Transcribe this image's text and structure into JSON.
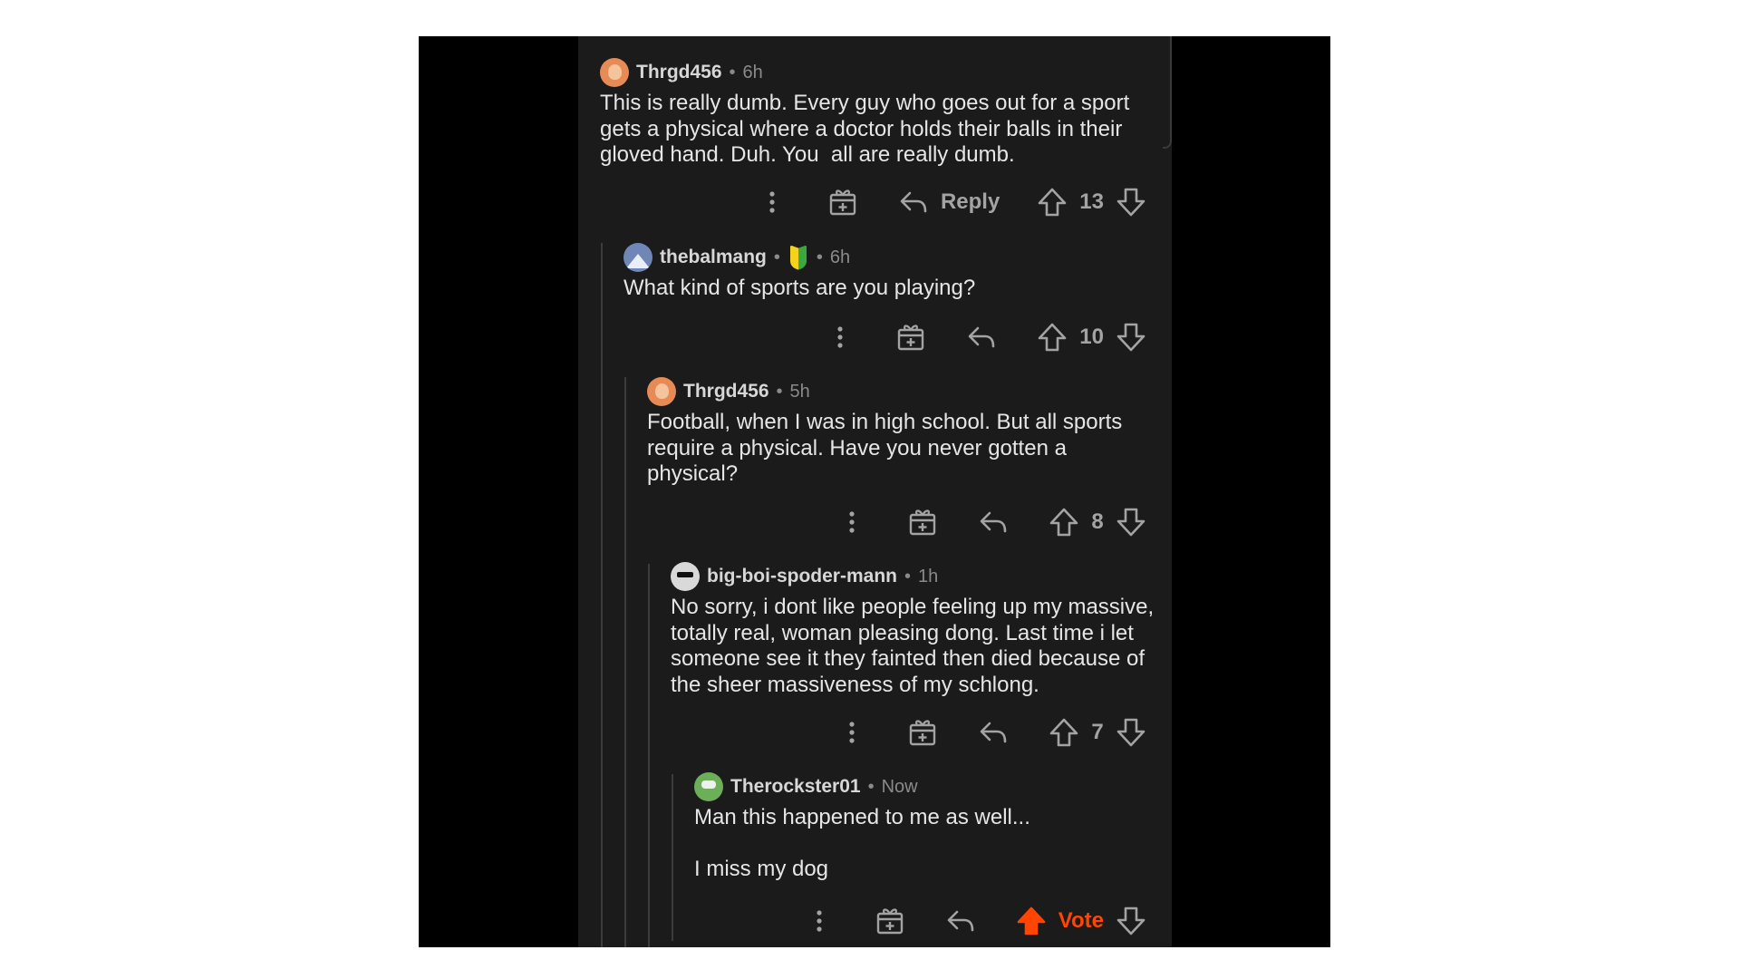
{
  "accent_color": "#ff4500",
  "icons": {
    "more": "kebab-vertical",
    "award": "gift-box",
    "reply": "reply-arrow",
    "upvote": "arrow-up",
    "downvote": "arrow-down"
  },
  "comments": [
    {
      "username": "Thrgd456",
      "time": "6h",
      "body": "This is really dumb. Every guy who goes out for a sport\ngets a physical where a doctor holds their balls in their\ngloved hand. Duh. You  all are really dumb.",
      "reply_label": "Reply",
      "score": "13"
    },
    {
      "username": "thebalmang",
      "time": "6h",
      "body": "What kind of sports are you playing?",
      "score": "10"
    },
    {
      "username": "Thrgd456",
      "time": "5h",
      "body": "Football, when I was in high school. But all sports\nrequire a physical. Have you never gotten a\nphysical?",
      "score": "8"
    },
    {
      "username": "big-boi-spoder-mann",
      "time": "1h",
      "body": "No sorry, i dont like people feeling up my massive,\ntotally real, woman pleasing dong. Last time i let\nsomeone see it they fainted then died because of\nthe sheer massiveness of my schlong.",
      "score": "7"
    },
    {
      "username": "Therockster01",
      "time": "Now",
      "body": "Man this happened to me as well...\n\nI miss my dog",
      "score": "Vote",
      "upvoted": true
    }
  ]
}
